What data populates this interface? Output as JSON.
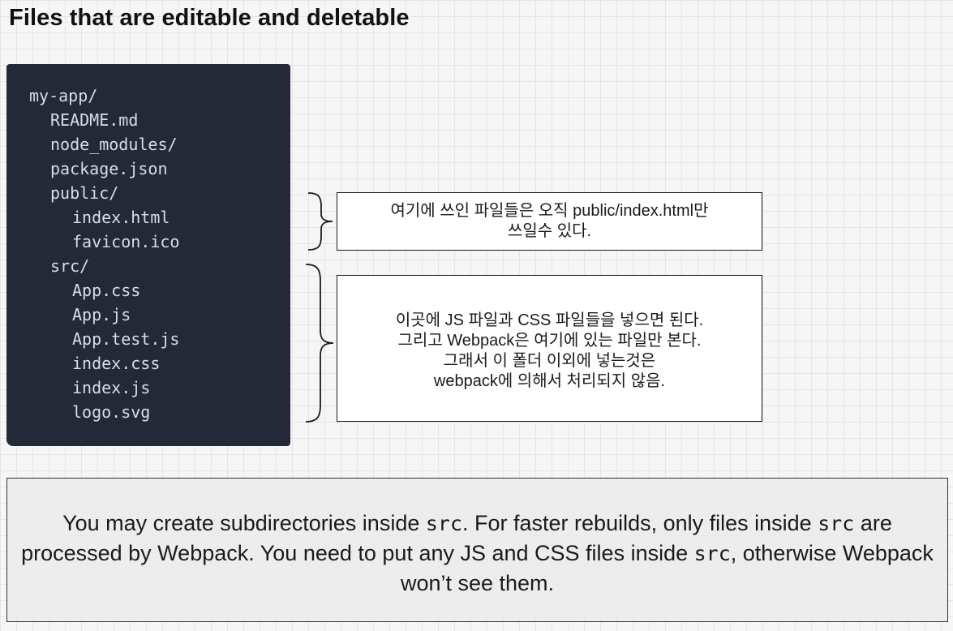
{
  "slide": {
    "title": "Files that are editable and deletable"
  },
  "file_tree": {
    "items": [
      {
        "label": "my-app/",
        "depth": 0
      },
      {
        "label": "README.md",
        "depth": 1
      },
      {
        "label": "node_modules/",
        "depth": 1
      },
      {
        "label": "package.json",
        "depth": 1
      },
      {
        "label": "public/",
        "depth": 1
      },
      {
        "label": "index.html",
        "depth": 2
      },
      {
        "label": "favicon.ico",
        "depth": 2
      },
      {
        "label": "src/",
        "depth": 1
      },
      {
        "label": "App.css",
        "depth": 2
      },
      {
        "label": "App.js",
        "depth": 2
      },
      {
        "label": "App.test.js",
        "depth": 2
      },
      {
        "label": "index.css",
        "depth": 2
      },
      {
        "label": "index.js",
        "depth": 2
      },
      {
        "label": "logo.svg",
        "depth": 2
      }
    ]
  },
  "notes": {
    "public": {
      "lines": [
        "여기에 쓰인 파일들은 오직 public/index.html만",
        "쓰일수 있다."
      ]
    },
    "src": {
      "lines": [
        "이곳에 JS 파일과 CSS 파일들을 넣으면 된다.",
        "그리고 Webpack은 여기에 있는 파일만 본다.",
        "그래서 이 폴더 이외에 넣는것은",
        "webpack에 의해서 처리되지 않음."
      ]
    }
  },
  "footer": {
    "part1": "You may create subdirectories inside ",
    "code1": "src",
    "part2": ". For faster rebuilds, only files inside ",
    "code2": "src",
    "part3": " are processed by Webpack. You need to put any JS and CSS files inside ",
    "code3": "src",
    "part4": ", otherwise Webpack won’t see them."
  }
}
